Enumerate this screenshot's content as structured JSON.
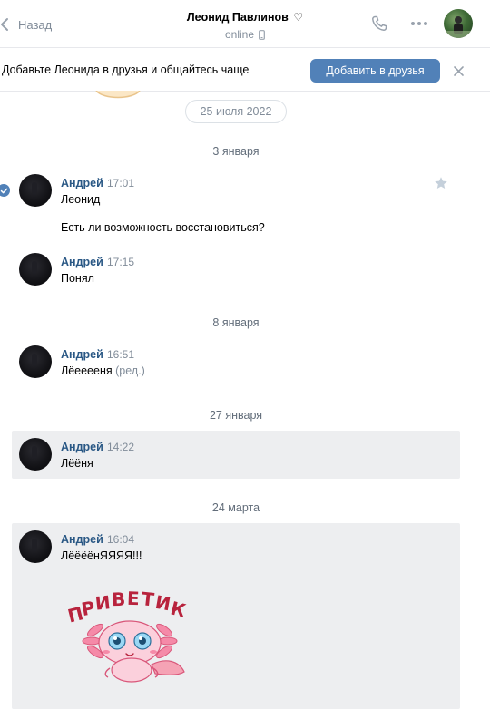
{
  "header": {
    "back_label": "Назад",
    "peer_name": "Леонид Павлинов",
    "peer_heart": "♡",
    "peer_status": "online"
  },
  "banner": {
    "text": "Добавьте Леонида в друзья и общайтесь чаще",
    "add_button": "Добавить в друзья"
  },
  "history_date": "25 июля 2022",
  "date_separators": [
    "3 января",
    "8 января",
    "27 января",
    "24 марта"
  ],
  "messages": [
    {
      "author": "Андрей",
      "time": "17:01",
      "lines": [
        "Леонид",
        "Есть ли возможность восстановиться?"
      ]
    },
    {
      "author": "Андрей",
      "time": "17:15",
      "lines": [
        "Понял"
      ]
    },
    {
      "author": "Андрей",
      "time": "16:51",
      "lines": [
        "Лёееееня"
      ],
      "edited_label": "(ред.)"
    },
    {
      "author": "Андрей",
      "time": "14:22",
      "lines": [
        "Лёёня"
      ]
    },
    {
      "author": "Андрей",
      "time": "16:04",
      "lines": [
        "ЛёёёёнЯЯЯЯ!!!"
      ],
      "sticker": {
        "text": "ПРИВЕТИК",
        "icon": "axolotl-sticker"
      }
    }
  ],
  "colors": {
    "accent": "#5181b8",
    "link": "#2a5885",
    "muted": "#818c99",
    "selected_bg": "#edeef0"
  }
}
